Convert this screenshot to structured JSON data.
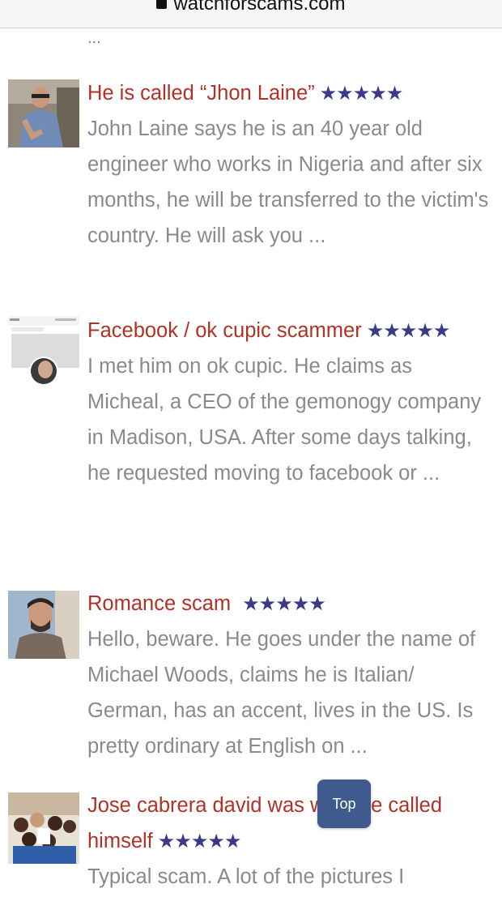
{
  "browser": {
    "url": "watchforscams.com",
    "lock_icon": "lock-icon"
  },
  "top_ellipsis": "...",
  "listings": [
    {
      "title": "He is called “Jhon Laine”",
      "stars": "★★★★★",
      "rating": 5,
      "description": "John Laine says he is an 40 year old engineer who works in Nigeria and after six months, he will be transferred to the victim's country. He will ask you ..."
    },
    {
      "title": "Facebook / ok cupic scammer",
      "stars": "★★★★★",
      "rating": 5,
      "description": "I met him on ok cupic. He claims as Micheal, a CEO of the gemonogy company in Madison, USA. After some days talking, he requested moving to facebook or ..."
    },
    {
      "title": "Romance scam",
      "stars": "★★★★★",
      "rating": 5,
      "description": "Hello, beware. He goes under the name of Michael Woods, claims he is Italian/ German, has an accent, lives in the US. Is pretty ordinary at English on ..."
    },
    {
      "title": "Jose cabrera david was what he called himself",
      "stars": "★★★★★",
      "rating": 5,
      "description": "Typical scam. A lot of the pictures I"
    }
  ],
  "top_button": {
    "label": "Top"
  },
  "colors": {
    "title": "#b03226",
    "stars": "#3a3a88",
    "text": "#8a8a8a",
    "top_button_bg": "#3f5a8c"
  }
}
